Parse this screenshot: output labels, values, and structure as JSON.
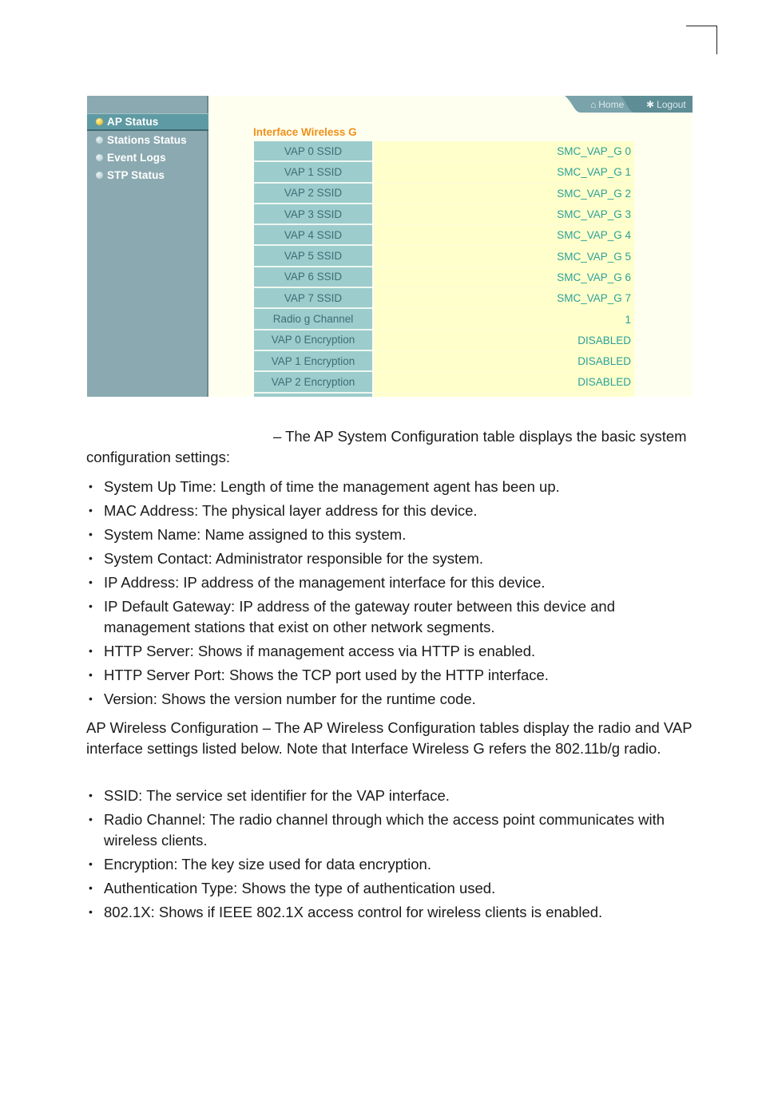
{
  "sidebar": {
    "items": [
      {
        "label": "AP Status",
        "active": true
      },
      {
        "label": "Stations Status",
        "active": false
      },
      {
        "label": "Event Logs",
        "active": false
      },
      {
        "label": "STP  Status",
        "active": false
      }
    ]
  },
  "topnav": {
    "home_label": "Home",
    "logout_label": "Logout",
    "home_icon": "house-icon",
    "logout_icon": "running-person-icon"
  },
  "interface": {
    "title": "Interface Wireless G",
    "rows": [
      {
        "label": "VAP 0 SSID",
        "value": "SMC_VAP_G 0"
      },
      {
        "label": "VAP 1 SSID",
        "value": "SMC_VAP_G 1"
      },
      {
        "label": "VAP 2 SSID",
        "value": "SMC_VAP_G 2"
      },
      {
        "label": "VAP 3 SSID",
        "value": "SMC_VAP_G 3"
      },
      {
        "label": "VAP 4 SSID",
        "value": "SMC_VAP_G 4"
      },
      {
        "label": "VAP 5 SSID",
        "value": "SMC_VAP_G 5"
      },
      {
        "label": "VAP 6 SSID",
        "value": "SMC_VAP_G 6"
      },
      {
        "label": "VAP 7 SSID",
        "value": "SMC_VAP_G 7"
      },
      {
        "label": "Radio g Channel",
        "value": "1"
      },
      {
        "label": "VAP 0 Encryption",
        "value": "DISABLED"
      },
      {
        "label": "VAP 1 Encryption",
        "value": "DISABLED"
      },
      {
        "label": "VAP 2 Encryption",
        "value": "DISABLED"
      },
      {
        "label": "",
        "value": ""
      }
    ]
  },
  "colors": {
    "sidebar_bg": "#8ba9b0",
    "sidebar_active": "#5e9aa3",
    "title_orange": "#f0901a",
    "label_cell": "#9ccccc",
    "value_cell": "#ffffcc",
    "value_text": "#2aa09a"
  },
  "document": {
    "intro": "– The AP System Configuration table displays the basic system configuration settings:",
    "system_items": [
      "System Up Time: Length of time the management agent has been up.",
      "MAC Address: The physical layer address for this device.",
      "System Name: Name assigned to this system.",
      "System Contact: Administrator responsible for the system.",
      "IP Address: IP address of the management interface for this device.",
      "IP Default Gateway: IP address of the gateway router between this device and management stations that exist on other network segments.",
      "HTTP Server: Shows if management access via HTTP is enabled.",
      "HTTP Server Port: Shows the TCP port used by the HTTP interface.",
      "Version: Shows the version number for the runtime code."
    ],
    "wireless_para": "AP Wireless Configuration – The AP Wireless Configuration tables display the radio and VAP interface settings listed below. Note that Interface Wireless G refers the 802.11b/g radio.",
    "wireless_items": [
      "SSID: The service set identifier for the VAP interface.",
      "Radio Channel: The radio channel through which the access point communicates with wireless clients.",
      "Encryption: The key size used for data encryption.",
      "Authentication Type: Shows the type of authentication used.",
      "802.1X: Shows if IEEE 802.1X access control for wireless clients is enabled."
    ]
  }
}
